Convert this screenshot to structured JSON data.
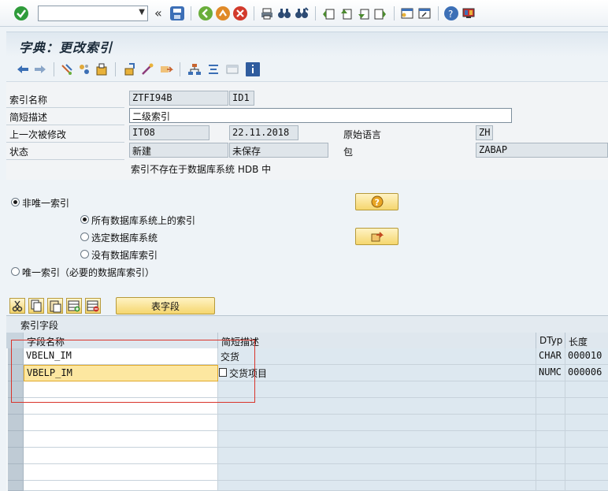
{
  "toolbar": {
    "icons": [
      "enter-icon",
      "command-dropdown",
      "save-icon",
      "back-icon",
      "exit-icon",
      "cancel-icon",
      "print-icon",
      "find-icon",
      "find-next-icon",
      "first-page-icon",
      "prev-page-icon",
      "next-page-icon",
      "last-page-icon",
      "create-session-icon",
      "shortcut-icon",
      "help-icon",
      "layout-icon"
    ]
  },
  "title": "字典：更改索引",
  "form": {
    "index_name_label": "索引名称",
    "index_table": "ZTFI94B",
    "index_id": "ID1",
    "short_desc_label": "简短描述",
    "short_desc_value": "二级索引",
    "last_changed_label": "上一次被修改",
    "last_changed_user": "IT08",
    "last_changed_date": "22.11.2018",
    "orig_lang_label": "原始语言",
    "orig_lang_value": "ZH",
    "status_label": "状态",
    "status_value": "新建",
    "save_status": "未保存",
    "package_label": "包",
    "package_value": "ZABAP",
    "db_message": "索引不存在于数据库系统 HDB 中"
  },
  "options": {
    "non_unique": "非唯一索引",
    "all_db": "所有数据库系统上的索引",
    "selected_db": "选定数据库系统",
    "no_db": "没有数据库索引",
    "unique": "唯一索引（必要的数据库索引）"
  },
  "table_toolbar": {
    "table_fields_button": "表字段"
  },
  "grid": {
    "title": "索引字段",
    "columns": [
      "字段名称",
      "简短描述",
      "DTyp",
      "长度"
    ],
    "rows": [
      {
        "field": "VBELN_IM",
        "desc": "交货",
        "dtype": "CHAR",
        "length": "000010"
      },
      {
        "field": "VBELP_IM",
        "desc": "交货项目",
        "dtype": "NUMC",
        "length": "000006"
      }
    ]
  },
  "colors": {
    "accent_yellow": "#f5d66e",
    "highlight_red": "#d9342b",
    "background": "#eef3f7"
  }
}
